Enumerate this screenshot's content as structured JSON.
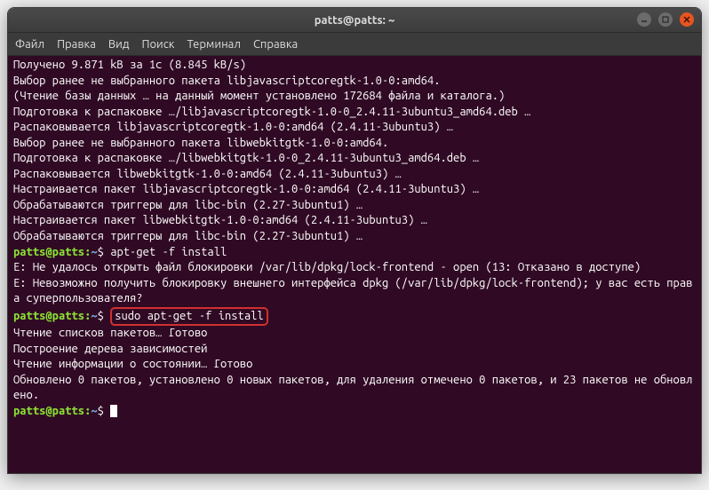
{
  "window": {
    "title": "patts@patts: ~"
  },
  "menu": {
    "file": "Файл",
    "edit": "Правка",
    "view": "Вид",
    "search": "Поиск",
    "terminal": "Терминал",
    "help": "Справка"
  },
  "term": {
    "l1": "Получено 9.871 kB за 1с (8.845 kB/s)",
    "l2": "Выбор ранее не выбранного пакета libjavascriptcoregtk-1.0-0:amd64.",
    "l3": "(Чтение базы данных … на данный момент установлено 172684 файла и каталога.)",
    "l4": "Подготовка к распаковке …/libjavascriptcoregtk-1.0-0_2.4.11-3ubuntu3_amd64.deb …",
    "l5": "Распаковывается libjavascriptcoregtk-1.0-0:amd64 (2.4.11-3ubuntu3) …",
    "l6": "Выбор ранее не выбранного пакета libwebkitgtk-1.0-0:amd64.",
    "l7": "Подготовка к распаковке …/libwebkitgtk-1.0-0_2.4.11-3ubuntu3_amd64.deb …",
    "l8": "Распаковывается libwebkitgtk-1.0-0:amd64 (2.4.11-3ubuntu3) …",
    "l9": "Настраивается пакет libjavascriptcoregtk-1.0-0:amd64 (2.4.11-3ubuntu3) …",
    "l10": "Обрабатываются триггеры для libc-bin (2.27-3ubuntu1) …",
    "l11": "Настраивается пакет libwebkitgtk-1.0-0:amd64 (2.4.11-3ubuntu3) …",
    "l12": "Обрабатываются триггеры для libc-bin (2.27-3ubuntu1) …",
    "prompt_user": "patts@patts",
    "prompt_sep": ":",
    "prompt_path": "~",
    "prompt_dollar": "$",
    "cmd1": " apt-get -f install",
    "err1": "E: Не удалось открыть файл блокировки /var/lib/dpkg/lock-frontend - open (13: Отказано в доступе)",
    "err2": "E: Невозможно получить блокировку внешнего интерфейса dpkg (/var/lib/dpkg/lock-frontend); у вас есть права суперпользователя?",
    "cmd2": "sudo apt-get -f install",
    "out1": "Чтение списков пакетов… Готово",
    "out2": "Построение дерева зависимостей",
    "out3": "Чтение информации о состоянии… Готово",
    "out4": "Обновлено 0 пакетов, установлено 0 новых пакетов, для удаления отмечено 0 пакетов, и 23 пакетов не обновлено."
  }
}
